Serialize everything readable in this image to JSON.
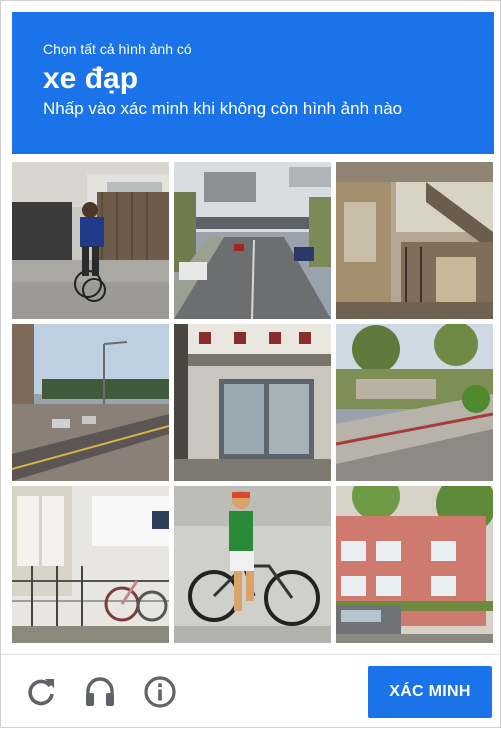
{
  "challenge": {
    "instruction_pre": "Chọn tất cả hình ảnh có",
    "target": "xe đạp",
    "instruction_post": "Nhấp vào xác minh khi không còn hình ảnh nào",
    "header_color": "#1a73e8"
  },
  "tiles": [
    {
      "row": 1,
      "col": 1,
      "scene": "person-riding-bicycle-on-sidewalk"
    },
    {
      "row": 1,
      "col": 2,
      "scene": "street-with-cars-and-overpass"
    },
    {
      "row": 1,
      "col": 3,
      "scene": "house-porch-stairs"
    },
    {
      "row": 2,
      "col": 1,
      "scene": "road-with-street-lights"
    },
    {
      "row": 2,
      "col": 2,
      "scene": "storefront-with-asian-sign"
    },
    {
      "row": 2,
      "col": 3,
      "scene": "sidewalk-and-lawn"
    },
    {
      "row": 3,
      "col": 1,
      "scene": "bicycle-leaning-on-fence"
    },
    {
      "row": 3,
      "col": 2,
      "scene": "boy-with-bicycle"
    },
    {
      "row": 3,
      "col": 3,
      "scene": "apartment-building-with-car"
    }
  ],
  "footer": {
    "reload_icon": "reload-icon",
    "audio_icon": "headphones-icon",
    "info_icon": "info-icon",
    "verify_label": "XÁC MINH",
    "verify_color": "#1a73e8"
  }
}
